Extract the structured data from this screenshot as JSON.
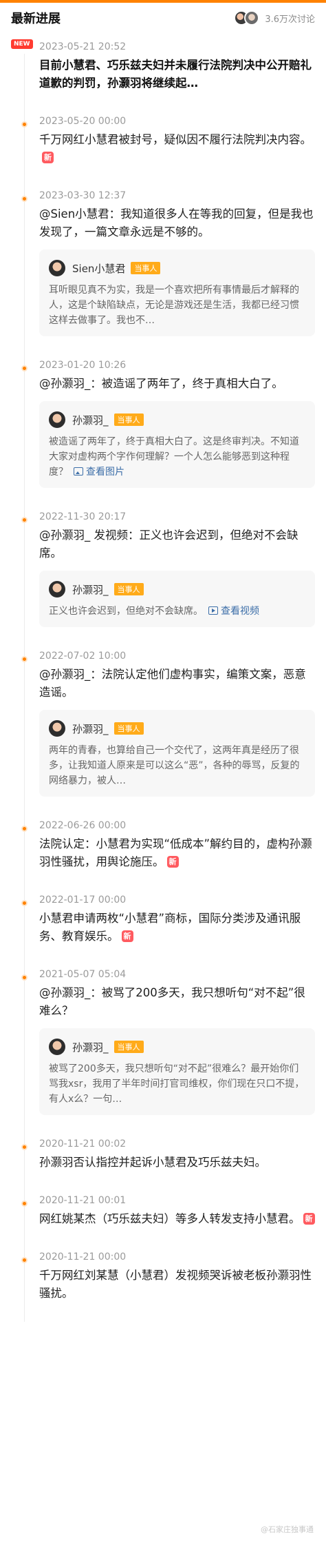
{
  "header": {
    "title": "最新进展",
    "discussion_count": "3.6万次讨论"
  },
  "events": [
    {
      "new_tag": "NEW",
      "time": "2023-05-21 20:52",
      "text": "目前小慧君、巧乐兹夫妇并未履行法院判决中公开赔礼道歉的判罚，孙灏羽将继续起…",
      "bold": true,
      "badge": ""
    },
    {
      "time": "2023-05-20 00:00",
      "text": "千万网红小慧君被封号，疑似因不履行法院判决内容。",
      "badge": "新"
    },
    {
      "time": "2023-03-30 12:37",
      "text": "@Sien小慧君：我知道很多人在等我的回复，但是我也发现了，一篇文章永远是不够的。",
      "quote": {
        "name": "Sien小慧君",
        "tag": "当事人",
        "text": "耳听眼见真不为实，我是一个喜欢把所有事情最后才解释的人，这是个缺陷缺点，无论是游戏还是生活，我都已经习惯这样去做事了。我也不…"
      }
    },
    {
      "time": "2023-01-20 10:26",
      "text": "@孙灏羽_：被造谣了两年了，终于真相大白了。",
      "quote": {
        "name": "孙灏羽_",
        "tag": "当事人",
        "text": "被造谣了两年了，终于真相大白了。这是终审判决。不知道大家对虚构两个字作何理解？一个人怎么能够恶到这种程度？",
        "link": "查看图片"
      }
    },
    {
      "time": "2022-11-30 20:17",
      "text": "@孙灏羽_ 发视频：正义也许会迟到，但绝对不会缺席。",
      "quote": {
        "name": "孙灏羽_",
        "tag": "当事人",
        "text": "正义也许会迟到，但绝对不会缺席。",
        "link": "查看视频"
      }
    },
    {
      "time": "2022-07-02 10:00",
      "text": "@孙灏羽_：法院认定他们虚构事实，编策文案，恶意造谣。",
      "quote": {
        "name": "孙灏羽_",
        "tag": "当事人",
        "text": "两年的青春，也算给自己一个交代了，这两年真是经历了很多，让我知道人原来是可以这么“恶”，各种的辱骂，反复的网络暴力，被人…"
      }
    },
    {
      "time": "2022-06-26 00:00",
      "text": "法院认定：小慧君为实现“低成本”解约目的，虚构孙灏羽性骚扰，用舆论施压。",
      "badge": "新"
    },
    {
      "time": "2022-01-17 00:00",
      "text": "小慧君申请两枚“小慧君”商标，国际分类涉及通讯服务、教育娱乐。",
      "badge": "新"
    },
    {
      "time": "2021-05-07 05:04",
      "text": "@孙灏羽_：被骂了200多天，我只想听句“对不起”很难么？",
      "quote": {
        "name": "孙灏羽_",
        "tag": "当事人",
        "text": "被骂了200多天，我只想听句“对不起”很难么？最开始你们骂我xsr，我用了半年时间打官司维权，你们现在只口不提，有人x么？一句…"
      }
    },
    {
      "time": "2020-11-21 00:02",
      "text": "孙灏羽否认指控并起诉小慧君及巧乐兹夫妇。"
    },
    {
      "time": "2020-11-21 00:01",
      "text": "网红姚某杰（巧乐兹夫妇）等多人转发支持小慧君。",
      "badge": "新"
    },
    {
      "time": "2020-11-21 00:00",
      "text": "千万网红刘某慧（小慧君）发视频哭诉被老板孙灏羽性骚扰。"
    }
  ],
  "watermark": "@石家庄独事通",
  "colors": {
    "accent": "#ff8200",
    "new_red": "#ff3b30",
    "tag_orange": "#ffab1a",
    "link_blue": "#3c6ea8"
  }
}
